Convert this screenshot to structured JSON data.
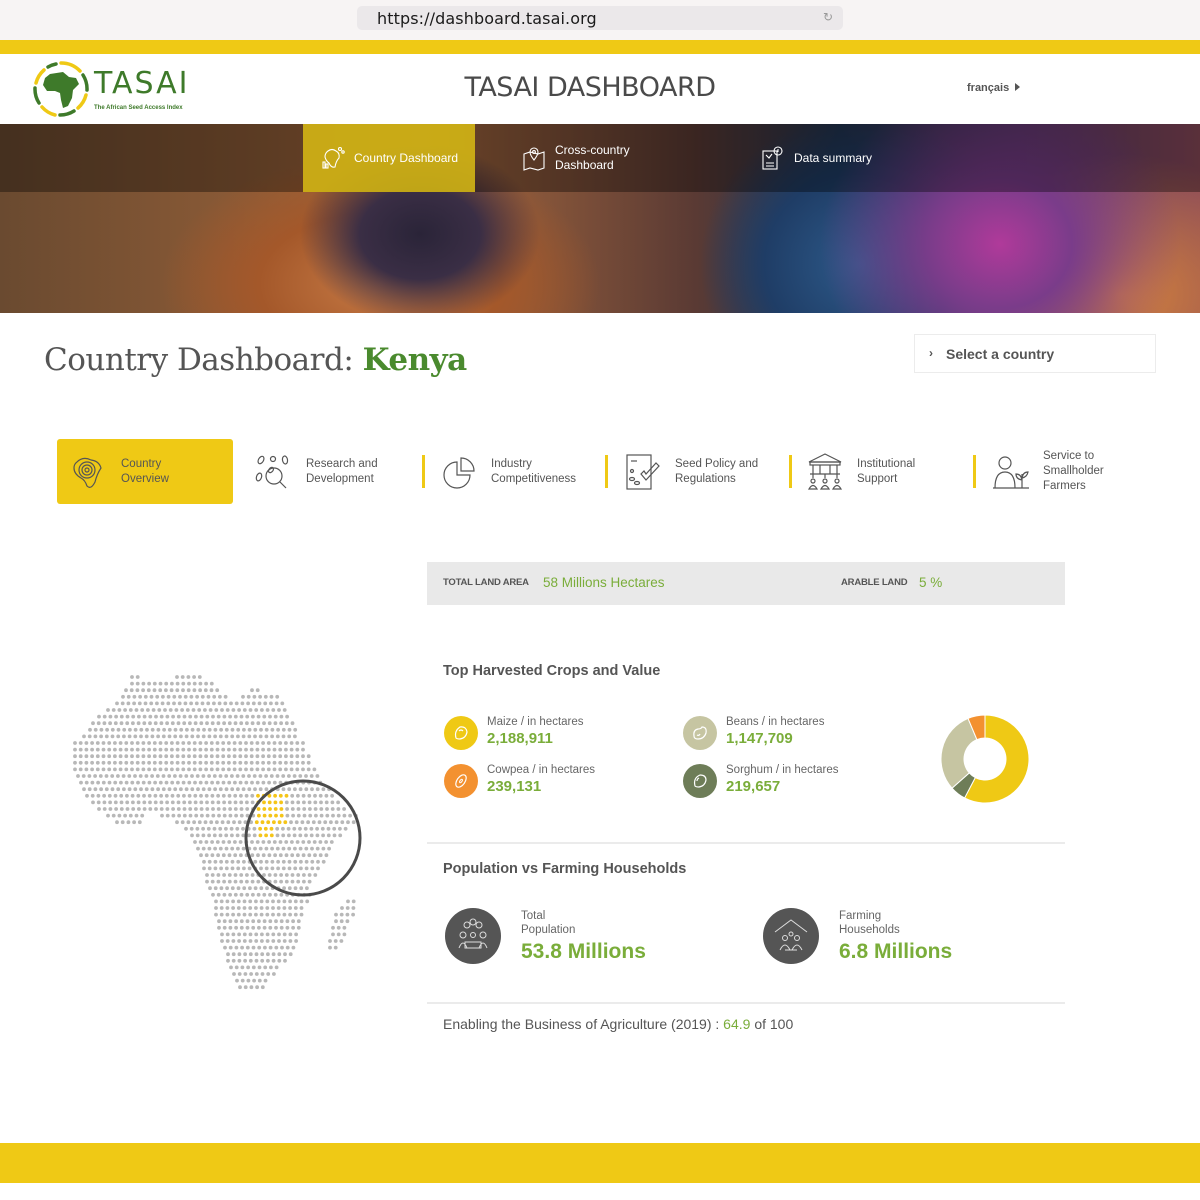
{
  "browser": {
    "url": "https://dashboard.tasai.org",
    "reload_icon": "reload-icon"
  },
  "header": {
    "logo_text": "TASAI",
    "logo_subtitle": "The African Seed Access Index",
    "title": "TASAI DASHBOARD",
    "language_link": "français"
  },
  "hero_nav": [
    {
      "label_1": "Country Dashboard",
      "label_2": "",
      "icon": "africa-chart-icon",
      "active": true
    },
    {
      "label_1": "Cross-country",
      "label_2": "Dashboard",
      "icon": "map-pin-icon",
      "active": false
    },
    {
      "label_1": "Data summary",
      "label_2": "",
      "icon": "report-icon",
      "active": false
    }
  ],
  "page": {
    "title_prefix": "Country Dashboard:",
    "country": "Kenya",
    "select_country_label": "Select a country"
  },
  "category_tabs": [
    {
      "line1": "Country",
      "line2": "Overview",
      "line3": "",
      "icon": "africa-target-icon",
      "active": true
    },
    {
      "line1": "Research and",
      "line2": "Development",
      "line3": "",
      "icon": "seeds-magnifier-icon",
      "active": false
    },
    {
      "line1": "Industry",
      "line2": "Competitiveness",
      "line3": "",
      "icon": "pie-chart-icon",
      "active": false
    },
    {
      "line1": "Seed Policy and",
      "line2": "Regulations",
      "line3": "",
      "icon": "document-check-icon",
      "active": false
    },
    {
      "line1": "Institutional",
      "line2": "Support",
      "line3": "",
      "icon": "institution-icon",
      "active": false
    },
    {
      "line1": "Service to",
      "line2": "Smallholder",
      "line3": "Farmers",
      "icon": "farmer-plant-icon",
      "active": false
    }
  ],
  "land": {
    "total_label": "TOTAL LAND AREA",
    "total_value": "58 Millions Hectares",
    "arable_label": "ARABLE LAND",
    "arable_value": "5 %"
  },
  "crops": {
    "heading": "Top Harvested Crops and Value",
    "items": [
      {
        "name": "Maize / in hectares",
        "value": "2,188,911",
        "color": "#efc915",
        "icon": "maize-kernel-icon"
      },
      {
        "name": "Beans / in hectares",
        "value": "1,147,709",
        "color": "#c6c5a2",
        "icon": "bean-icon"
      },
      {
        "name": "Cowpea / in hectares",
        "value": "239,131",
        "color": "#f39130",
        "icon": "cowpea-icon"
      },
      {
        "name": "Sorghum / in hectares",
        "value": "219,657",
        "color": "#6e7d58",
        "icon": "sorghum-grain-icon"
      }
    ]
  },
  "chart_data": {
    "type": "pie",
    "title": "Top Harvested Crops and Value",
    "donut": true,
    "categories": [
      "Maize",
      "Sorghum",
      "Beans",
      "Cowpea"
    ],
    "values": [
      2188911,
      219657,
      1147709,
      239131
    ],
    "colors": [
      "#efc915",
      "#6e7d58",
      "#c6c5a2",
      "#f39130"
    ],
    "unit": "hectares",
    "legend": "none"
  },
  "population": {
    "heading": "Population vs Farming Households",
    "total_label_1": "Total",
    "total_label_2": "Population",
    "total_value": "53.8 Millions",
    "farming_label_1": "Farming",
    "farming_label_2": "Households",
    "farming_value": "6.8 Millions"
  },
  "eba": {
    "label": "Enabling the Business of Agriculture (2019) :",
    "score": "64.9",
    "suffix": "of 100"
  },
  "map": {
    "highlight_country": "Kenya",
    "highlight_color": "#f5c518",
    "dot_color": "#b8b8b8"
  }
}
